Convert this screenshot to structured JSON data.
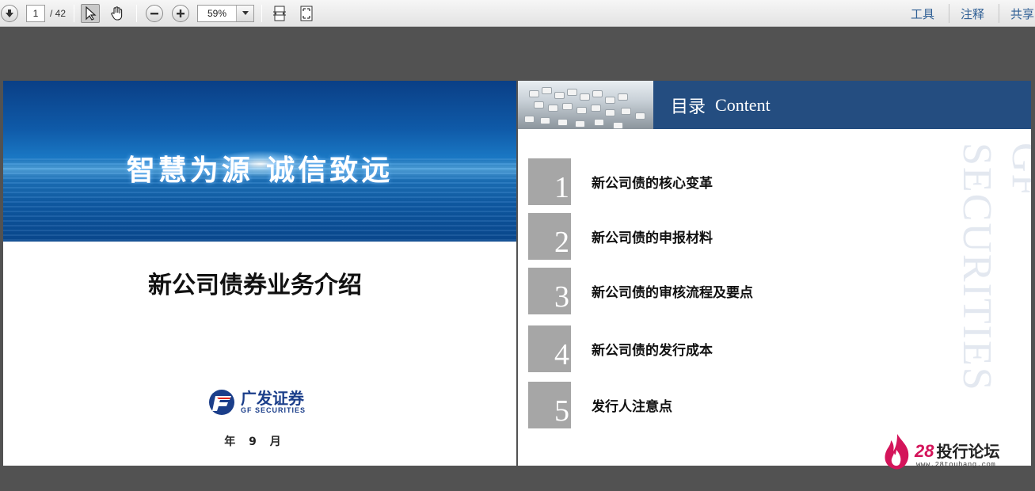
{
  "toolbar": {
    "page_current": "1",
    "page_total": "/ 42",
    "zoom": "59%",
    "menu": [
      "工具",
      "注释",
      "共享"
    ]
  },
  "slide_left": {
    "slogan": "智慧为源 诚信致远",
    "title": "新公司债券业务介绍",
    "logo_cn": "广发证券",
    "logo_en": "GF SECURITIES",
    "date": "年 9 月"
  },
  "slide_right": {
    "header_cn": "目录",
    "header_en": "Content",
    "items": [
      {
        "num": "1",
        "label": "新公司债的核心变革"
      },
      {
        "num": "2",
        "label": "新公司债的申报材料"
      },
      {
        "num": "3",
        "label": "新公司债的审核流程及要点"
      },
      {
        "num": "4",
        "label": "新公司债的发行成本"
      },
      {
        "num": "5",
        "label": "发行人注意点"
      }
    ],
    "watermark": "GF SECURITIES"
  },
  "forum": {
    "num": "28",
    "name": "投行论坛",
    "url": "www.28touhang.com"
  },
  "colors": {
    "header_blue": "#244d80",
    "menu_blue": "#2f5f95",
    "num_box_gray": "#a6a6a6",
    "forum_red": "#d4145a"
  }
}
